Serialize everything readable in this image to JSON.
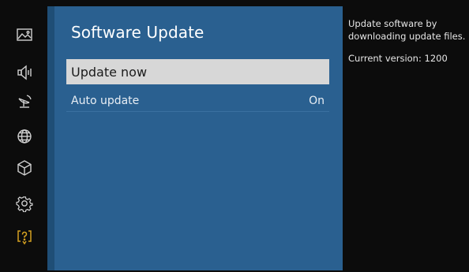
{
  "sidebar": {
    "icons": [
      {
        "name": "picture-icon"
      },
      {
        "name": "sound-icon"
      },
      {
        "name": "broadcasting-icon"
      },
      {
        "name": "network-icon"
      },
      {
        "name": "smart-features-icon"
      },
      {
        "name": "general-settings-icon"
      },
      {
        "name": "support-icon",
        "active": true,
        "color": "#d4a020"
      }
    ]
  },
  "panel": {
    "title": "Software Update",
    "items": [
      {
        "label": "Update now",
        "selected": true
      },
      {
        "label": "Auto update",
        "value": "On"
      }
    ]
  },
  "info": {
    "description": "Update software by downloading update files.",
    "current_version": "Current version: 1200"
  },
  "colors": {
    "panel_bg": "#2a6090",
    "selected_bg": "#d7d7d7",
    "accent": "#d4a020"
  }
}
